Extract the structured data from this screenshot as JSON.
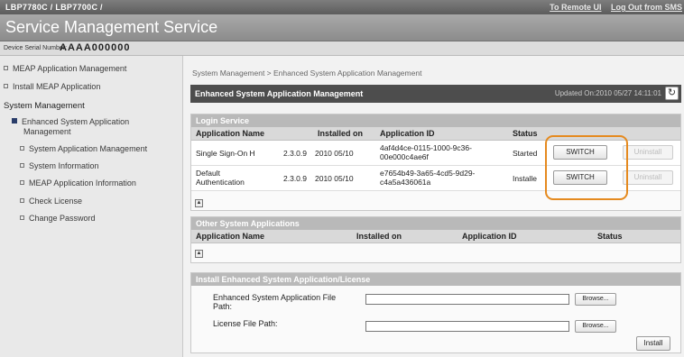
{
  "topbar": {
    "product": "LBP7780C / LBP7700C /",
    "remote_ui_link": "To Remote UI",
    "logout_link": "Log Out from SMS"
  },
  "title": "Service Management Service",
  "serial": {
    "label": "Device Serial Number:",
    "value": "AAAA000000"
  },
  "sidebar": {
    "items": [
      {
        "label": "MEAP Application Management"
      },
      {
        "label": "Install MEAP Application"
      }
    ],
    "section_label": "System Management",
    "sub_items": [
      {
        "label": "Enhanced System Application",
        "label2": "Management"
      },
      {
        "label": "System Application Management"
      },
      {
        "label": "System Information"
      },
      {
        "label": "MEAP Application Information"
      },
      {
        "label": "Check License"
      },
      {
        "label": "Change Password"
      }
    ]
  },
  "breadcrumb": "System Management > Enhanced System Application Management",
  "panel": {
    "title": "Enhanced System Application Management",
    "updated": "Updated On:2010 05/27 14:11:01"
  },
  "login_service": {
    "title": "Login Service",
    "columns": [
      "Application Name",
      "Installed on",
      "Application ID",
      "Status"
    ],
    "rows": [
      {
        "name": "Single Sign-On H",
        "version": "2.3.0.9",
        "installed": "2010 05/10",
        "id1": "4af4d4ce-0115-1000-9c36-",
        "id2": "00e000c4ae6f",
        "status": "Started",
        "switch": "SWITCH",
        "uninstall": "Uninstall"
      },
      {
        "name": "Default",
        "name2": "Authentication",
        "version": "2.3.0.9",
        "installed": "2010 05/10",
        "id1": "e7654b49-3a65-4cd5-9d29-",
        "id2": "c4a5a436061a",
        "status": "Installe",
        "switch": "SWITCH",
        "uninstall": "Uninstall"
      }
    ]
  },
  "other_apps": {
    "title": "Other System Applications",
    "columns": [
      "Application Name",
      "Installed on",
      "Application ID",
      "Status"
    ]
  },
  "install": {
    "title": "Install Enhanced System Application/License",
    "file_label": "Enhanced System Application File",
    "file_label2": "Path:",
    "license_label": "License File Path:",
    "browse": "Browse...",
    "install_button": "Install"
  },
  "colors": {
    "highlight": "#e58a1f",
    "panel_header": "#4d4d4d"
  },
  "icons": [
    "refresh-icon",
    "collapse-icon",
    "bullet-icon"
  ]
}
